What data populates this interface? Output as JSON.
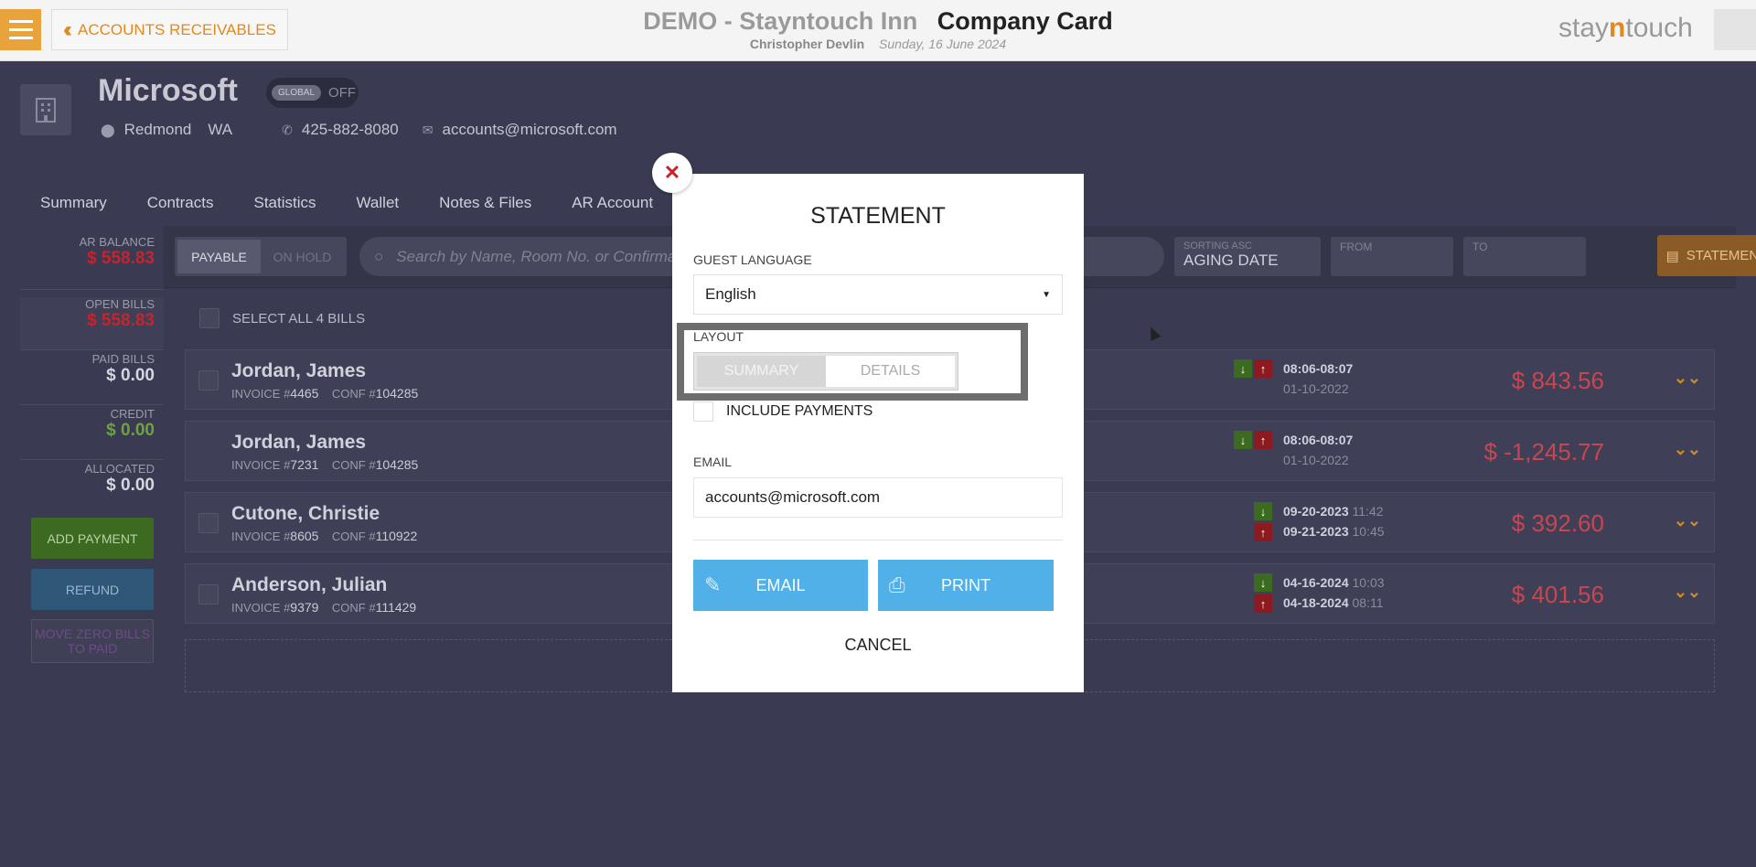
{
  "topbar": {
    "back_label": "ACCOUNTS RECEIVABLES",
    "title_demo": "DEMO - Stayntouch Inn",
    "title_page": "Company Card",
    "user": "Christopher Devlin",
    "date": "Sunday, 16 June 2024",
    "logo_left": "stay",
    "logo_mid": "n",
    "logo_right": "touch"
  },
  "company": {
    "name": "Microsoft",
    "global_label": "GLOBAL",
    "global_state": "OFF",
    "city": "Redmond",
    "state": "WA",
    "phone": "425-882-8080",
    "email": "accounts@microsoft.com"
  },
  "tabs": [
    "Summary",
    "Contracts",
    "Statistics",
    "Wallet",
    "Notes & Files",
    "AR Account"
  ],
  "sidebar": {
    "ar_balance_label": "AR BALANCE",
    "ar_balance": "$ 558.83",
    "open_bills_label": "OPEN BILLS",
    "open_bills": "$ 558.83",
    "paid_bills_label": "PAID BILLS",
    "paid_bills": "$ 0.00",
    "credit_label": "CREDIT",
    "credit": "$ 0.00",
    "allocated_label": "ALLOCATED",
    "allocated": "$ 0.00",
    "add_payment": "ADD PAYMENT",
    "refund": "REFUND",
    "move_zero": "MOVE ZERO BILLS TO PAID"
  },
  "toolbar": {
    "payable": "PAYABLE",
    "on_hold": "ON HOLD",
    "search_placeholder": "Search by Name, Room No. or Confirmati",
    "sorting_label": "SORTING ASC",
    "sorting_value": "AGING DATE",
    "from_label": "FROM",
    "to_label": "TO",
    "statement_label": "STATEMENT"
  },
  "select_all": "SELECT ALL 4 BILLS",
  "bills": [
    {
      "name": "Jordan, James",
      "invoice": "4465",
      "conf": "104285",
      "date1": "08:06-08:07",
      "time1": "",
      "date2": "01-10-2022",
      "time2": "",
      "amount": "$ 843.56"
    },
    {
      "name": "Jordan, James",
      "invoice": "7231",
      "conf": "104285",
      "date1": "08:06-08:07",
      "time1": "",
      "date2": "01-10-2022",
      "time2": "",
      "amount": "$ -1,245.77"
    },
    {
      "name": "Cutone, Christie",
      "invoice": "8605",
      "conf": "110922",
      "date1": "09-20-2023",
      "time1": "11:42",
      "date2": "09-21-2023",
      "time2": "10:45",
      "amount": "$ 392.60"
    },
    {
      "name": "Anderson, Julian",
      "invoice": "9379",
      "conf": "111429",
      "date1": "04-16-2024",
      "time1": "10:03",
      "date2": "04-18-2024",
      "time2": "08:11",
      "amount": "$ 401.56"
    }
  ],
  "labels": {
    "invoice": "INVOICE #",
    "conf": "CONF #"
  },
  "modal": {
    "title": "STATEMENT",
    "guest_language_label": "GUEST LANGUAGE",
    "language": "English",
    "layout_label": "LAYOUT",
    "layout_summary": "SUMMARY",
    "layout_details": "DETAILS",
    "include_payments": "INCLUDE PAYMENTS",
    "email_label": "EMAIL",
    "email_value": "accounts@microsoft.com",
    "email_btn": "EMAIL",
    "print_btn": "PRINT",
    "cancel": "CANCEL"
  }
}
